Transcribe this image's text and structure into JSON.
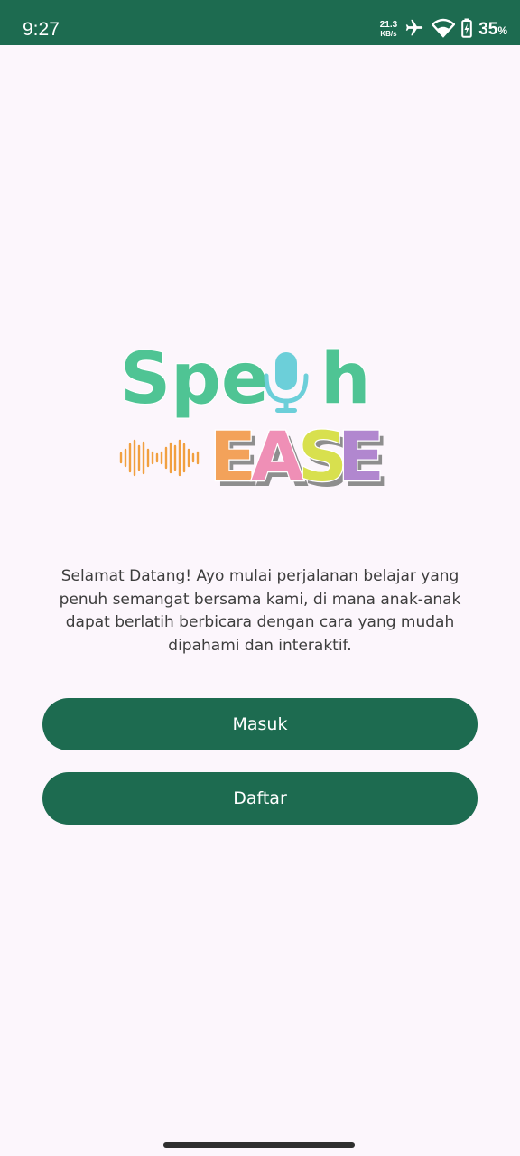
{
  "status_bar": {
    "time": "9:27",
    "net_speed_value": "21.3",
    "net_speed_unit": "KB/s",
    "battery_percent": "35",
    "battery_unit": "%",
    "icons": [
      "airplane-icon",
      "wifi-icon",
      "battery-icon"
    ]
  },
  "logo": {
    "word_top": "Speech",
    "word_bottom": "EASE"
  },
  "welcome_text": "Selamat Datang! Ayo mulai perjalanan belajar yang penuh semangat bersama kami, di mana anak-anak dapat berlatih berbicara dengan cara yang mudah dipahami dan interaktif.",
  "buttons": {
    "login": "Masuk",
    "register": "Daftar"
  },
  "colors": {
    "primary": "#1d6b50",
    "background": "#fcf6fc",
    "logo_green": "#4fc494",
    "logo_mic": "#6ccfd9",
    "ease_e1": "#f3a25a",
    "ease_a": "#ef8fb6",
    "ease_s": "#d8e04e",
    "ease_e2": "#b187cf",
    "wave_orange": "#f1a040"
  }
}
